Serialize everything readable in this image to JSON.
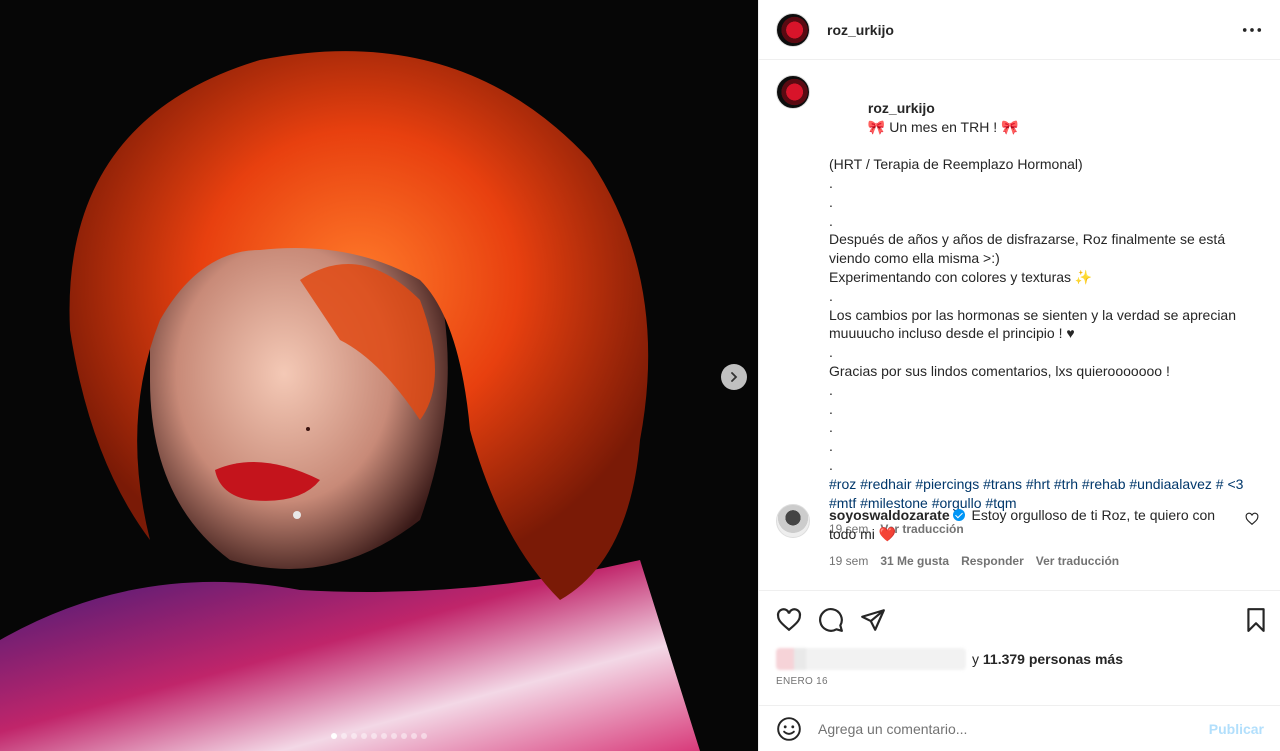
{
  "post": {
    "username": "roz_urkijo",
    "caption_lines": [
      "(HRT / Terapia de Reemplazo Hormonal)",
      ".",
      ".",
      ".",
      "Después de años y años de disfrazarse, Roz finalmente se está viendo como ella misma >:)",
      "Experimentando con colores y texturas ✨",
      ".",
      "Los cambios por las hormonas se sienten y la verdad se aprecian muuuucho incluso desde el principio ! ♥",
      ".",
      "Gracias por sus lindos comentarios, lxs quierooooooo !",
      ".",
      ".",
      ".",
      ".",
      "."
    ],
    "caption_first": "🎀 Un mes en TRH ! 🎀",
    "hashtags": "#roz #redhair #piercings #trans #hrt #trh #rehab #undiaalavez # <3 #mtf #milestone #orgullo #tqm",
    "caption_time": "19 sem",
    "translate": "Ver traducción",
    "likes_suffix": "y",
    "likes_count": "11.379 personas más",
    "date": "ENERO 16",
    "carousel": {
      "current": 1,
      "total": 10
    }
  },
  "comment": {
    "username": "soyoswaldozarate",
    "text": "Estoy orgulloso de ti Roz, te quiero con todo mi ❤️",
    "time": "19 sem",
    "likes": "31 Me gusta",
    "reply": "Responder",
    "translate": "Ver traducción"
  },
  "add_comment": {
    "placeholder": "Agrega un comentario...",
    "publish": "Publicar"
  },
  "colors": {
    "link": "#00376b",
    "publish_disabled": "#b2dffc",
    "verified": "#0095f6",
    "heart": "#ed4956"
  },
  "icons": [
    "more-icon",
    "next-arrow-icon",
    "heart-icon",
    "comment-icon",
    "share-icon",
    "bookmark-icon",
    "emoji-icon",
    "verified-icon"
  ]
}
